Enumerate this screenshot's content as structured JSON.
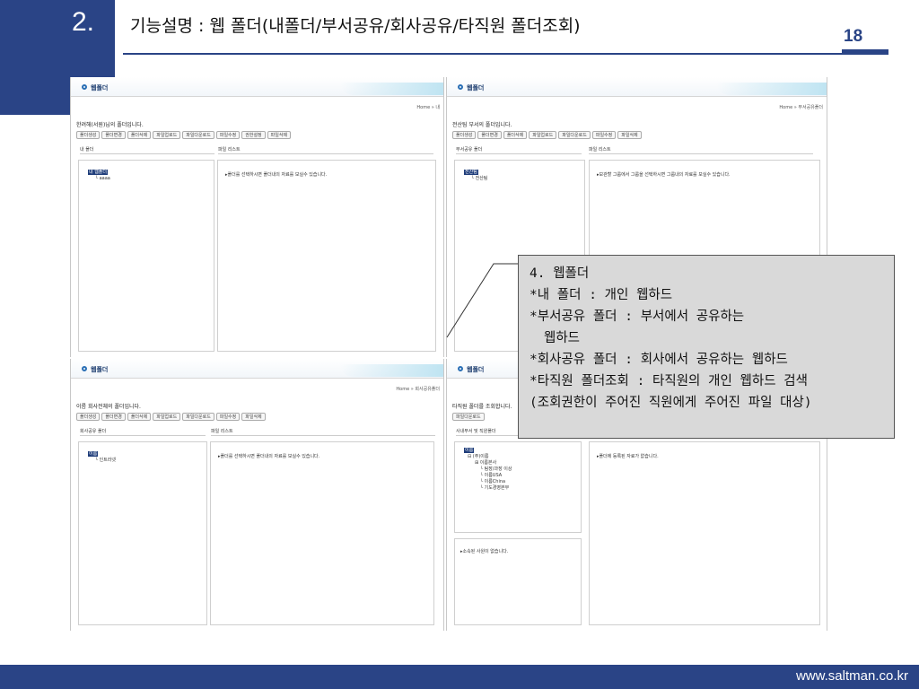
{
  "slide": {
    "number": "2.",
    "title": "기능설명 : 웹 폴더(내폴더/부서공유/회사공유/타직원 폴더조회)",
    "page": "18",
    "footer_url": "www.saltman.co.kr"
  },
  "panels": {
    "my_folder": {
      "header": "웹폴더",
      "breadcrumb": "Home » 내",
      "description": "한려해(서원)님의 폴더입니다.",
      "buttons": [
        "폴더생성",
        "폴더변경",
        "폴더삭제",
        "파일업로드",
        "파일다운로드",
        "파일수정",
        "권한설정",
        "파일삭제"
      ],
      "left_col": "내 폴더",
      "right_col": "파일 리스트",
      "tree": [
        "내 웹폴더",
        "aaaa"
      ],
      "message": "▸폴더를 선택하시면 폴더내의 자료를 보실수 있습니다."
    },
    "dept_share": {
      "header": "웹폴더",
      "breadcrumb": "Home » 부서공유폴더",
      "description": "전산팀 부서의 폴더입니다.",
      "buttons": [
        "폴더생성",
        "폴더변경",
        "폴더삭제",
        "파일업로드",
        "파일다운로드",
        "파일수정",
        "파일삭제"
      ],
      "left_col": "부서공유 폴더",
      "right_col": "파일 리스트",
      "tree": [
        "전산팀",
        "전산팀"
      ],
      "message": "▸보관할 그룹에서 그룹을 선택하시면 그룹내의 자료를 보실수 있습니다."
    },
    "company_share": {
      "header": "웹폴더",
      "breadcrumb": "Home » 회사공유폴더",
      "description": "이름 회사전체의 폴더입니다.",
      "buttons": [
        "폴더생성",
        "폴더변경",
        "폴더삭제",
        "파일업로드",
        "파일다운로드",
        "파일수정",
        "파일삭제"
      ],
      "left_col": "회사공유 폴더",
      "right_col": "파일 리스트",
      "tree": [
        "이름",
        "인트라넷"
      ],
      "message": "▸폴더를 선택하시면 폴더내의 자료를 보실수 있습니다."
    },
    "other_staff": {
      "header": "웹폴더",
      "description": "타직원 폴더를 조회합니다.",
      "buttons": [
        "파일다운로드"
      ],
      "left_col": "사내부서 및 직원폴더",
      "tree": [
        "이름",
        "(주)이름",
        "이름본사",
        "팀장/과장 이상",
        "이름USA",
        "이름China",
        "기도경영본부"
      ],
      "message": "▸폴더에 등록된 자료가 없습니다.",
      "staff_message": "▸소속된 사원이 없습니다."
    }
  },
  "callout": {
    "lines": [
      "4. 웹폴더",
      "*내 폴더 : 개인 웹하드",
      "*부서공유 폴더 : 부서에서 공유하는",
      "웹하드",
      "*회사공유 폴더 : 회사에서 공유하는 웹하드",
      "*타직원 폴더조회 : 타직원의 개인 웹하드 검색",
      "(조회권한이 주어진 직원에게 주어진 파일 대상)"
    ]
  },
  "colors": {
    "brand": "#2a4486",
    "callout_bg": "#d9d9d9",
    "tree_selected": "#1f3d7a"
  }
}
